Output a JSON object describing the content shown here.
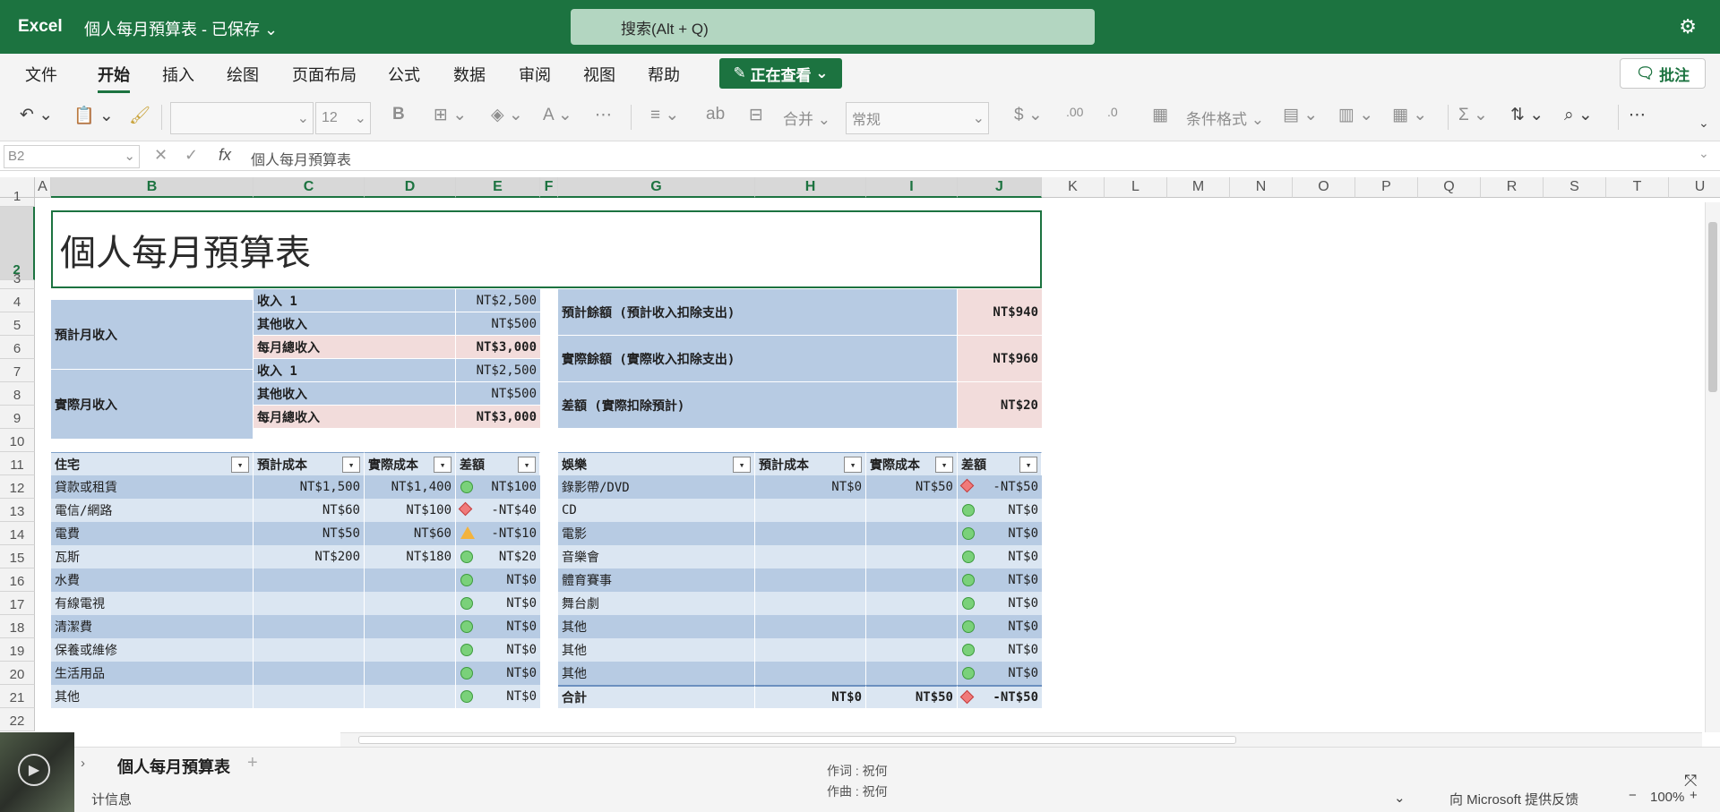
{
  "app": {
    "name": "Excel",
    "doc_title": "個人每月預算表 - 已保存",
    "search_placeholder": "搜索(Alt + Q)"
  },
  "menu": {
    "items": [
      "文件",
      "开始",
      "插入",
      "绘图",
      "页面布局",
      "公式",
      "数据",
      "审阅",
      "视图",
      "帮助"
    ],
    "active": "开始",
    "viewing": "正在查看",
    "comment": "批注"
  },
  "toolbar": {
    "font_size": "12",
    "merge": "合并",
    "number_format": "常规",
    "cond_format": "条件格式"
  },
  "formula": {
    "namebox": "B2",
    "content": "個人每月預算表"
  },
  "columns": [
    "A",
    "B",
    "C",
    "D",
    "E",
    "F",
    "G",
    "H",
    "I",
    "J",
    "K",
    "L",
    "M",
    "N",
    "O",
    "P",
    "Q",
    "R",
    "S",
    "T",
    "U"
  ],
  "rows": [
    "1",
    "2",
    "3",
    "4",
    "5",
    "6",
    "7",
    "8",
    "9",
    "10",
    "11",
    "12",
    "13",
    "14",
    "15",
    "16",
    "17",
    "18",
    "19",
    "20",
    "21",
    "22"
  ],
  "title": "個人每月預算表",
  "income": {
    "planned_label": "預計月收入",
    "actual_label": "實際月收入",
    "planned": [
      {
        "label": "收入 1",
        "value": "NT$2,500"
      },
      {
        "label": "其他收入",
        "value": "NT$500"
      },
      {
        "label": "每月總收入",
        "value": "NT$3,000"
      }
    ],
    "actual": [
      {
        "label": "收入 1",
        "value": "NT$2,500"
      },
      {
        "label": "其他收入",
        "value": "NT$500"
      },
      {
        "label": "每月總收入",
        "value": "NT$3,000"
      }
    ]
  },
  "balance": [
    {
      "label": "預計餘額 (預計收入扣除支出)",
      "value": "NT$940"
    },
    {
      "label": "實際餘額 (實際收入扣除支出)",
      "value": "NT$960"
    },
    {
      "label": "差額 (實際扣除預計)",
      "value": "NT$20"
    }
  ],
  "housing": {
    "headers": [
      "住宅",
      "預計成本",
      "實際成本",
      "差額"
    ],
    "rows": [
      {
        "item": "貸款或租賃",
        "planned": "NT$1,500",
        "actual": "NT$1,400",
        "diff": "NT$100",
        "ind": "green"
      },
      {
        "item": "電信/網路",
        "planned": "NT$60",
        "actual": "NT$100",
        "diff": "-NT$40",
        "ind": "red"
      },
      {
        "item": "電費",
        "planned": "NT$50",
        "actual": "NT$60",
        "diff": "-NT$10",
        "ind": "yellow"
      },
      {
        "item": "瓦斯",
        "planned": "NT$200",
        "actual": "NT$180",
        "diff": "NT$20",
        "ind": "green"
      },
      {
        "item": "水費",
        "planned": "",
        "actual": "",
        "diff": "NT$0",
        "ind": "green"
      },
      {
        "item": "有線電視",
        "planned": "",
        "actual": "",
        "diff": "NT$0",
        "ind": "green"
      },
      {
        "item": "清潔費",
        "planned": "",
        "actual": "",
        "diff": "NT$0",
        "ind": "green"
      },
      {
        "item": "保養或維修",
        "planned": "",
        "actual": "",
        "diff": "NT$0",
        "ind": "green"
      },
      {
        "item": "生活用品",
        "planned": "",
        "actual": "",
        "diff": "NT$0",
        "ind": "green"
      },
      {
        "item": "其他",
        "planned": "",
        "actual": "",
        "diff": "NT$0",
        "ind": "green"
      }
    ]
  },
  "entertainment": {
    "headers": [
      "娛樂",
      "預計成本",
      "實際成本",
      "差額"
    ],
    "rows": [
      {
        "item": "錄影帶/DVD",
        "planned": "NT$0",
        "actual": "NT$50",
        "diff": "-NT$50",
        "ind": "red"
      },
      {
        "item": "CD",
        "planned": "",
        "actual": "",
        "diff": "NT$0",
        "ind": "green"
      },
      {
        "item": "電影",
        "planned": "",
        "actual": "",
        "diff": "NT$0",
        "ind": "green"
      },
      {
        "item": "音樂會",
        "planned": "",
        "actual": "",
        "diff": "NT$0",
        "ind": "green"
      },
      {
        "item": "體育賽事",
        "planned": "",
        "actual": "",
        "diff": "NT$0",
        "ind": "green"
      },
      {
        "item": "舞台劇",
        "planned": "",
        "actual": "",
        "diff": "NT$0",
        "ind": "green"
      },
      {
        "item": "其他",
        "planned": "",
        "actual": "",
        "diff": "NT$0",
        "ind": "green"
      },
      {
        "item": "其他",
        "planned": "",
        "actual": "",
        "diff": "NT$0",
        "ind": "green"
      },
      {
        "item": "其他",
        "planned": "",
        "actual": "",
        "diff": "NT$0",
        "ind": "green"
      }
    ],
    "total": {
      "item": "合計",
      "planned": "NT$0",
      "actual": "NT$50",
      "diff": "-NT$50",
      "ind": "red"
    }
  },
  "sheet_tab": "個人每月預算表",
  "captions": [
    "作词 : 祝何",
    "作曲 : 祝何"
  ],
  "status": {
    "left": "计信息",
    "feedback": "向 Microsoft 提供反馈",
    "zoom": "100%"
  },
  "colors": {
    "brand": "#1c7340",
    "table_dark": "#b7cbe3",
    "table_light": "#dbe6f2",
    "pink": "#f2dcdb"
  }
}
